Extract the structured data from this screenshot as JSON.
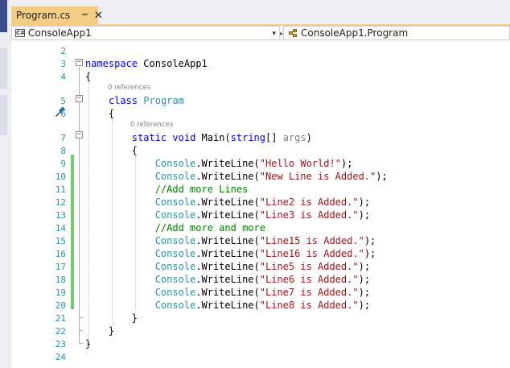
{
  "tab": {
    "title": "Program.cs",
    "pin_glyph": "⭲",
    "close_glyph": "✕"
  },
  "nav": {
    "project_badge": "C#",
    "project": "ConsoleApp1",
    "class": "ConsoleApp1.Program",
    "dropdown_glyph": "▾"
  },
  "code_lens": "0 references",
  "lines": [
    {
      "n": "2",
      "html": ""
    },
    {
      "n": "3",
      "tokens": [
        [
          "kw",
          "namespace"
        ],
        [
          "",
          " ConsoleApp1"
        ]
      ]
    },
    {
      "n": "4",
      "tokens": [
        [
          "",
          "{"
        ]
      ]
    },
    {
      "n": "5",
      "tokens": [
        [
          "",
          "    "
        ],
        [
          "kw",
          "class"
        ],
        [
          "",
          " "
        ],
        [
          "ty",
          "Program"
        ]
      ]
    },
    {
      "n": "6",
      "tokens": [
        [
          "",
          "    {"
        ]
      ]
    },
    {
      "n": "7",
      "tokens": [
        [
          "",
          "        "
        ],
        [
          "kw",
          "static"
        ],
        [
          "",
          " "
        ],
        [
          "kw",
          "void"
        ],
        [
          "",
          " Main("
        ],
        [
          "kw",
          "string"
        ],
        [
          "",
          "[] "
        ],
        [
          "par",
          "args"
        ],
        [
          "",
          ")"
        ]
      ]
    },
    {
      "n": "8",
      "tokens": [
        [
          "",
          "        {"
        ]
      ]
    },
    {
      "n": "9",
      "tokens": [
        [
          "",
          "            "
        ],
        [
          "ty",
          "Console"
        ],
        [
          "",
          ".WriteLine("
        ],
        [
          "str",
          "\"Hello World!\""
        ],
        [
          "",
          ");"
        ]
      ]
    },
    {
      "n": "10",
      "tokens": [
        [
          "",
          "            "
        ],
        [
          "ty",
          "Console"
        ],
        [
          "",
          ".WriteLine("
        ],
        [
          "str",
          "\"New Line is Added.\""
        ],
        [
          "",
          ");"
        ]
      ]
    },
    {
      "n": "11",
      "tokens": [
        [
          "",
          "            "
        ],
        [
          "com",
          "//Add more Lines"
        ]
      ]
    },
    {
      "n": "12",
      "tokens": [
        [
          "",
          "            "
        ],
        [
          "ty",
          "Console"
        ],
        [
          "",
          ".WriteLine("
        ],
        [
          "str",
          "\"Line2 is Added.\""
        ],
        [
          "",
          ");"
        ]
      ]
    },
    {
      "n": "13",
      "tokens": [
        [
          "",
          "            "
        ],
        [
          "ty",
          "Console"
        ],
        [
          "",
          ".WriteLine("
        ],
        [
          "str",
          "\"Line3 is Added.\""
        ],
        [
          "",
          ");"
        ]
      ]
    },
    {
      "n": "14",
      "tokens": [
        [
          "",
          "            "
        ],
        [
          "com",
          "//Add more and more"
        ]
      ]
    },
    {
      "n": "15",
      "tokens": [
        [
          "",
          "            "
        ],
        [
          "ty",
          "Console"
        ],
        [
          "",
          ".WriteLine("
        ],
        [
          "str",
          "\"Line15 is Added.\""
        ],
        [
          "",
          ");"
        ]
      ]
    },
    {
      "n": "16",
      "tokens": [
        [
          "",
          "            "
        ],
        [
          "ty",
          "Console"
        ],
        [
          "",
          ".WriteLine("
        ],
        [
          "str",
          "\"Line16 is Added.\""
        ],
        [
          "",
          ");"
        ]
      ]
    },
    {
      "n": "17",
      "tokens": [
        [
          "",
          "            "
        ],
        [
          "ty",
          "Console"
        ],
        [
          "",
          ".WriteLine("
        ],
        [
          "str",
          "\"Line5 is Added.\""
        ],
        [
          "",
          ");"
        ]
      ]
    },
    {
      "n": "18",
      "tokens": [
        [
          "",
          "            "
        ],
        [
          "ty",
          "Console"
        ],
        [
          "",
          ".WriteLine("
        ],
        [
          "str",
          "\"Line6 is Added.\""
        ],
        [
          "",
          ");"
        ]
      ]
    },
    {
      "n": "19",
      "tokens": [
        [
          "",
          "            "
        ],
        [
          "ty",
          "Console"
        ],
        [
          "",
          ".WriteLine("
        ],
        [
          "str",
          "\"Line7 is Added.\""
        ],
        [
          "",
          ");"
        ]
      ]
    },
    {
      "n": "20",
      "tokens": [
        [
          "",
          "            "
        ],
        [
          "ty",
          "Console"
        ],
        [
          "",
          ".WriteLine("
        ],
        [
          "str",
          "\"Line8 is Added.\""
        ],
        [
          "",
          ");"
        ]
      ]
    },
    {
      "n": "21",
      "tokens": [
        [
          "",
          "        }"
        ]
      ]
    },
    {
      "n": "22",
      "tokens": [
        [
          "",
          "    }"
        ]
      ]
    },
    {
      "n": "23",
      "tokens": [
        [
          "",
          "}"
        ]
      ]
    },
    {
      "n": "24",
      "tokens": []
    }
  ],
  "colors": {
    "keyword": "#0000ff",
    "type": "#2b91af",
    "string": "#a31515",
    "comment": "#008000",
    "line_number": "#2b91af",
    "tab_active": "#f5cc84",
    "change_bar": "#6fcf6f"
  },
  "icons": [
    "csharp-project-icon",
    "class-icon",
    "pin-icon",
    "close-icon",
    "quick-action-screwdriver-icon"
  ]
}
